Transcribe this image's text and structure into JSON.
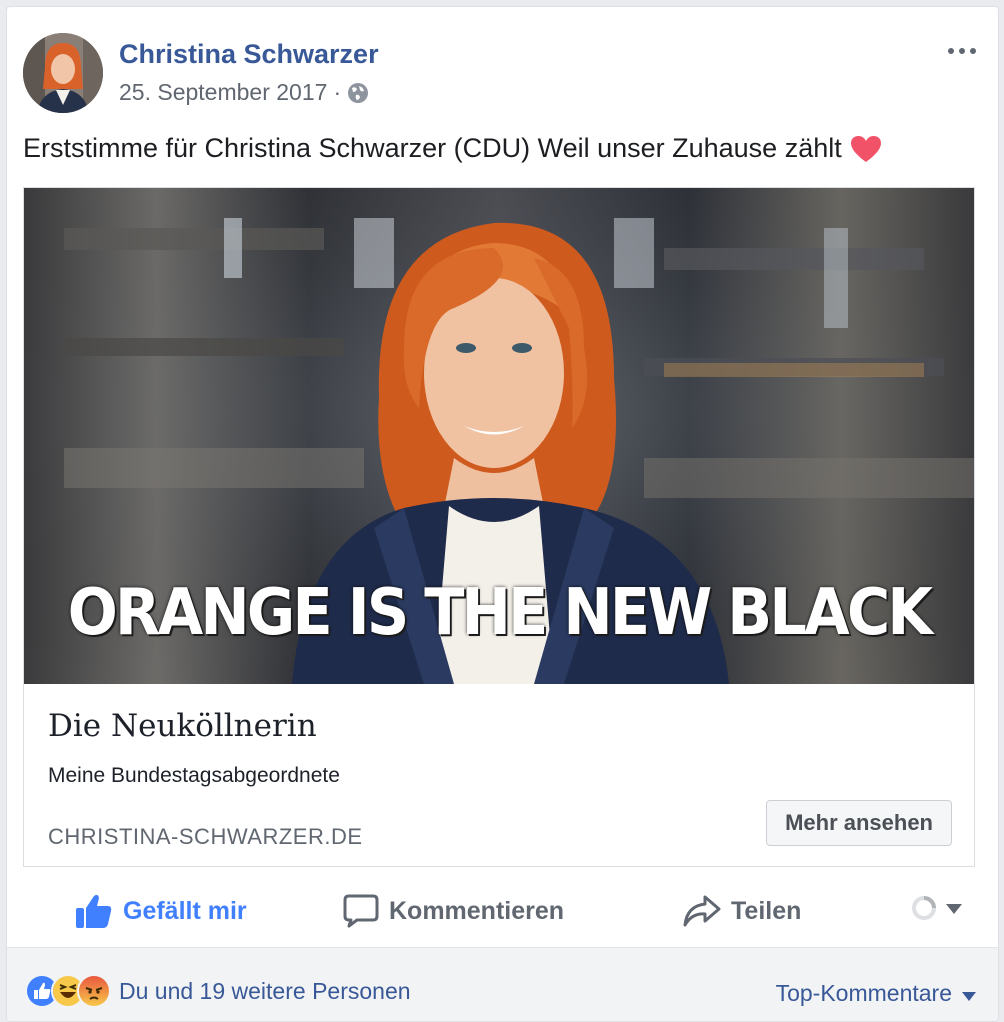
{
  "post": {
    "author": "Christina Schwarzer",
    "date": "25. September 2017",
    "separator": "·",
    "privacy_icon": "globe-icon",
    "text": "Erststimme für Christina Schwarzer (CDU) Weil unser Zuhause zählt",
    "emoji_icon": "heart-icon"
  },
  "link_preview": {
    "image_caption": "ORANGE IS THE NEW BLACK",
    "title": "Die Neuköllnerin",
    "description": "Meine Bundestagsabgeordnete",
    "domain": "CHRISTINA-SCHWARZER.DE",
    "button_label": "Mehr ansehen"
  },
  "actions": {
    "like_label": "Gefällt mir",
    "comment_label": "Kommentieren",
    "share_label": "Teilen"
  },
  "footer": {
    "reactions": [
      "like-reaction-icon",
      "haha-reaction-icon",
      "angry-reaction-icon"
    ],
    "reactions_text": "Du und 19 weitere Personen",
    "sort_label": "Top-Kommentare"
  },
  "colors": {
    "link_blue": "#385898",
    "like_blue": "#4080ff",
    "text_dark": "#1c1e21",
    "text_grey": "#606770",
    "footer_bg": "#f2f3f5"
  }
}
